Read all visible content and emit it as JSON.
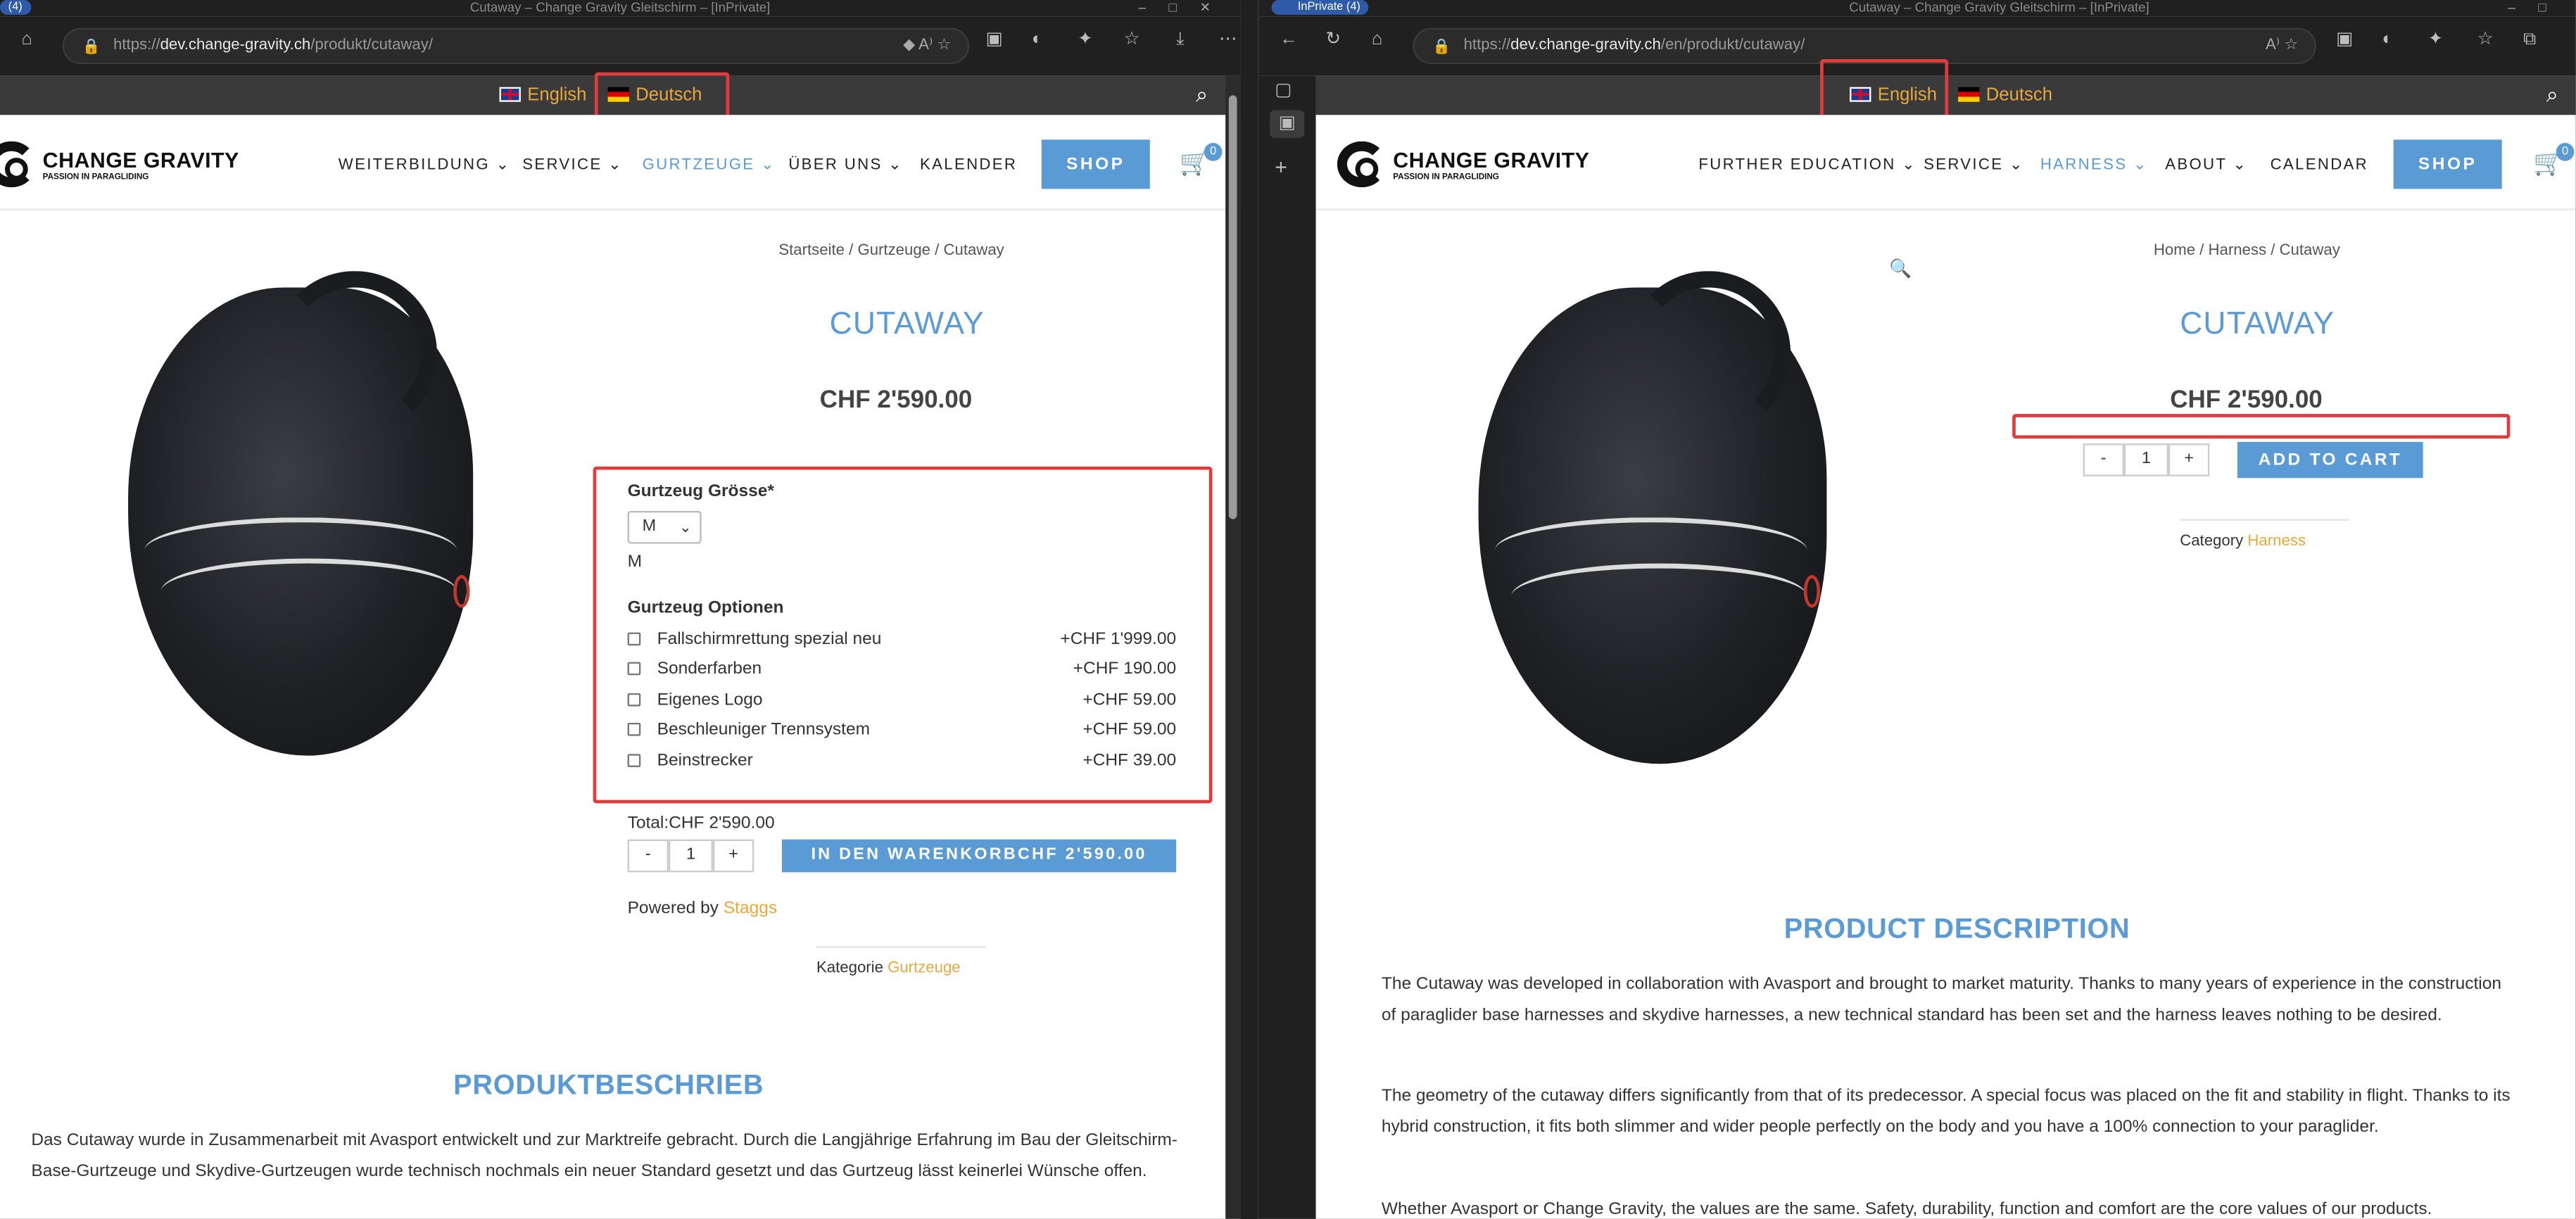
{
  "left": {
    "tab_count": "(4)",
    "window_title": "Cutaway – Change Gravity Gleitschirm – [InPrivate]",
    "url_prefix": "https://",
    "url_host": "dev.change-gravity.ch",
    "url_path": "/produkt/cutaway/",
    "lang_english": "English",
    "lang_deutsch": "Deutsch",
    "logo_name": "CHANGE GRAVITY",
    "logo_tagline": "PASSION IN PARAGLIDING",
    "nav": [
      "WEITERBILDUNG",
      "SERVICE",
      "GURTZEUGE",
      "ÜBER UNS",
      "KALENDER"
    ],
    "shop": "SHOP",
    "cart_count": "0",
    "breadcrumb": "Startseite / Gurtzeuge / Cutaway",
    "title": "CUTAWAY",
    "price": "CHF 2'590.00",
    "size_label": "Gurtzeug Grösse*",
    "size_value": "M",
    "size_selected_text": "M",
    "options_label": "Gurtzeug Optionen",
    "options": [
      {
        "name": "Fallschirmrettung spezial neu",
        "price": "+CHF 1'999.00"
      },
      {
        "name": "Sonderfarben",
        "price": "+CHF 190.00"
      },
      {
        "name": "Eigenes Logo",
        "price": "+CHF 59.00"
      },
      {
        "name": "Beschleuniger Trennsystem",
        "price": "+CHF 59.00"
      },
      {
        "name": "Beinstrecker",
        "price": "+CHF 39.00"
      }
    ],
    "total": "Total:CHF 2'590.00",
    "qty_minus": "-",
    "qty_value": "1",
    "qty_plus": "+",
    "add_to_cart": "IN DEN WARENKORBCHF 2'590.00",
    "powered_by": "Powered by",
    "powered_link": "Staggs",
    "category_label": "Kategorie",
    "category_value": "Gurtzeuge",
    "section_title": "PRODUKTBESCHRIEB",
    "desc": "Das Cutaway wurde in Zusammenarbeit mit Avasport entwickelt und zur Marktreife gebracht. Durch die Langjährige Erfahrung im Bau der Gleitschirm-Base-Gurtzeuge und Skydive-Gurtzeugen wurde technisch nochmals ein neuer Standard gesetzt und das Gurtzeug lässt keinerlei Wünsche offen."
  },
  "right": {
    "badge": "InPrivate (4)",
    "window_title": "Cutaway – Change Gravity Gleitschirm – [InPrivate]",
    "url_prefix": "https://",
    "url_host": "dev.change-gravity.ch",
    "url_path": "/en/produkt/cutaway/",
    "lang_english": "English",
    "lang_deutsch": "Deutsch",
    "logo_name": "CHANGE GRAVITY",
    "logo_tagline": "PASSION IN PARAGLIDING",
    "nav": [
      "FURTHER EDUCATION",
      "SERVICE",
      "HARNESS",
      "ABOUT",
      "CALENDAR"
    ],
    "shop": "SHOP",
    "cart_count": "0",
    "breadcrumb": "Home / Harness / Cutaway",
    "title": "CUTAWAY",
    "price": "CHF 2'590.00",
    "qty_minus": "-",
    "qty_value": "1",
    "qty_plus": "+",
    "add_to_cart": "ADD TO CART",
    "category_label": "Category",
    "category_value": "Harness",
    "section_title": "PRODUCT DESCRIPTION",
    "desc1": "The Cutaway was developed in collaboration with Avasport and brought to market maturity. Thanks to many years of experience in the construction of paraglider base harnesses and skydive harnesses, a new technical standard has been set and the harness leaves nothing to be desired.",
    "desc2": "The geometry of the cutaway differs significantly from that of its predecessor. A special focus was placed on the fit and stability in flight. Thanks to its hybrid construction, it fits both slimmer and wider people perfectly on the body and you have a 100% connection to your paraglider.",
    "desc3": "Whether Avasport or Change Gravity, the values are the same. Safety, durability, function and comfort are the core values of our products."
  },
  "colors": {
    "accent": "#5b9bd5",
    "link": "#e8a93c",
    "highlight": "#e23b3b"
  }
}
